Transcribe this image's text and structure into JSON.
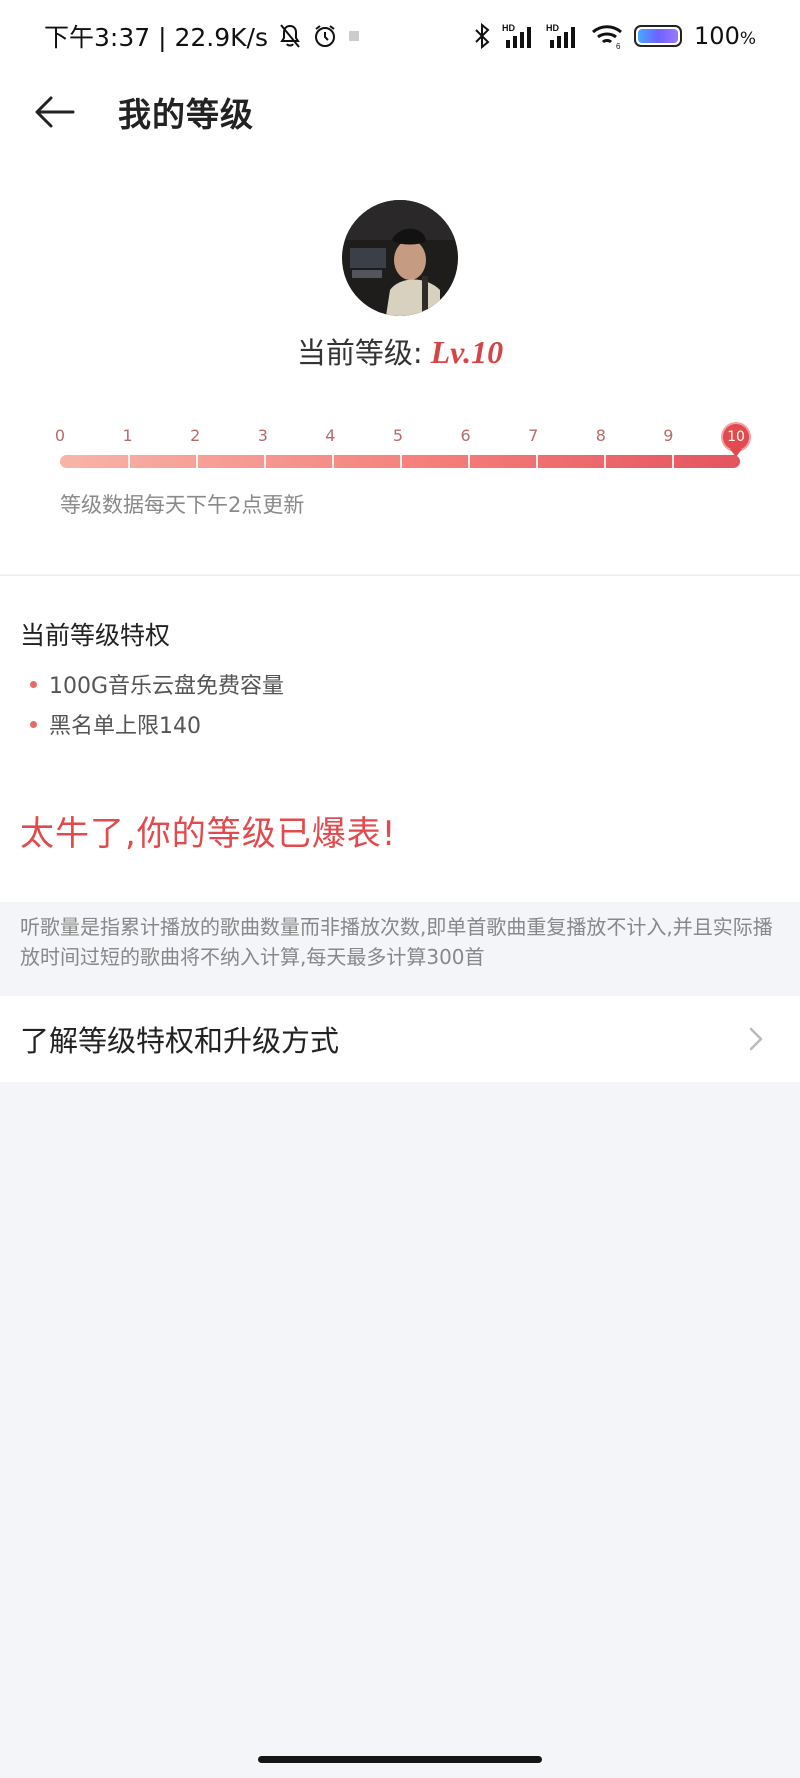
{
  "status_bar": {
    "time_speed": "下午3:37 | 22.9K/s",
    "battery_pct": "100",
    "battery_unit": "%",
    "battery_level": 100,
    "icons": [
      "bell-off-icon",
      "alarm-icon",
      "bluetooth-icon",
      "hd-signal-icon",
      "hd-signal-icon",
      "wifi-icon",
      "battery-icon"
    ]
  },
  "header": {
    "title": "我的等级",
    "back_icon": "arrow-left-icon"
  },
  "level": {
    "label": "当前等级:",
    "value": "Lv.10",
    "current": 10,
    "ticks": [
      "0",
      "1",
      "2",
      "3",
      "4",
      "5",
      "6",
      "7",
      "8",
      "9",
      "10"
    ],
    "update_note": "等级数据每天下午2点更新"
  },
  "privileges": {
    "title": "当前等级特权",
    "items": [
      "100G音乐云盘免费容量",
      "黑名单上限140"
    ]
  },
  "max_level_message": "太牛了,你的等级已爆表!",
  "info_text": "听歌量是指累计播放的歌曲数量而非播放次数,即单首歌曲重复播放不计入,并且实际播放时间过短的歌曲将不纳入计算,每天最多计算300首",
  "upgrade_link": {
    "label": "了解等级特权和升级方式",
    "icon": "chevron-right-icon"
  },
  "colors": {
    "accent": "#e24a4d",
    "bar_start": "#f8b4a9",
    "bar_end": "#e4555f",
    "page_bg": "#f4f5f9"
  }
}
